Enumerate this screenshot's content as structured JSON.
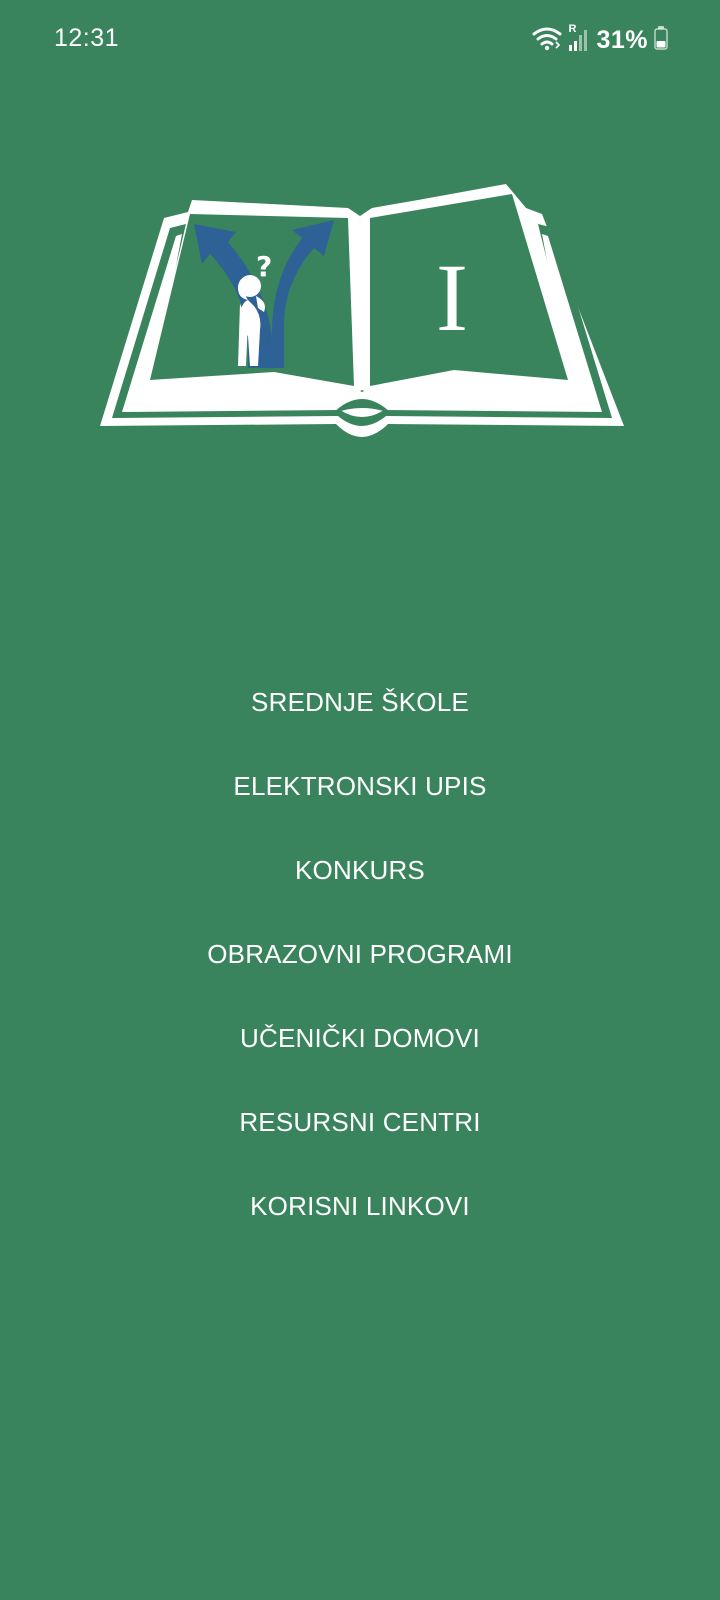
{
  "status_bar": {
    "time": "12:31",
    "battery_percent": "31%",
    "wifi_icon": "wifi-icon",
    "signal_icon": "signal-icon",
    "roaming_label": "R",
    "battery_icon": "battery-icon"
  },
  "logo": {
    "book_letter": "I",
    "question_mark": "?"
  },
  "colors": {
    "background": "#39845C",
    "text": "#FFFFFF",
    "arrow_blue": "#2E6296"
  },
  "menu": {
    "items": [
      {
        "label": "SREDNJE ŠKOLE"
      },
      {
        "label": "ELEKTRONSKI UPIS"
      },
      {
        "label": "KONKURS"
      },
      {
        "label": "OBRAZOVNI PROGRAMI"
      },
      {
        "label": "UČENIČKI DOMOVI"
      },
      {
        "label": "RESURSNI CENTRI"
      },
      {
        "label": "KORISNI LINKOVI"
      }
    ]
  }
}
